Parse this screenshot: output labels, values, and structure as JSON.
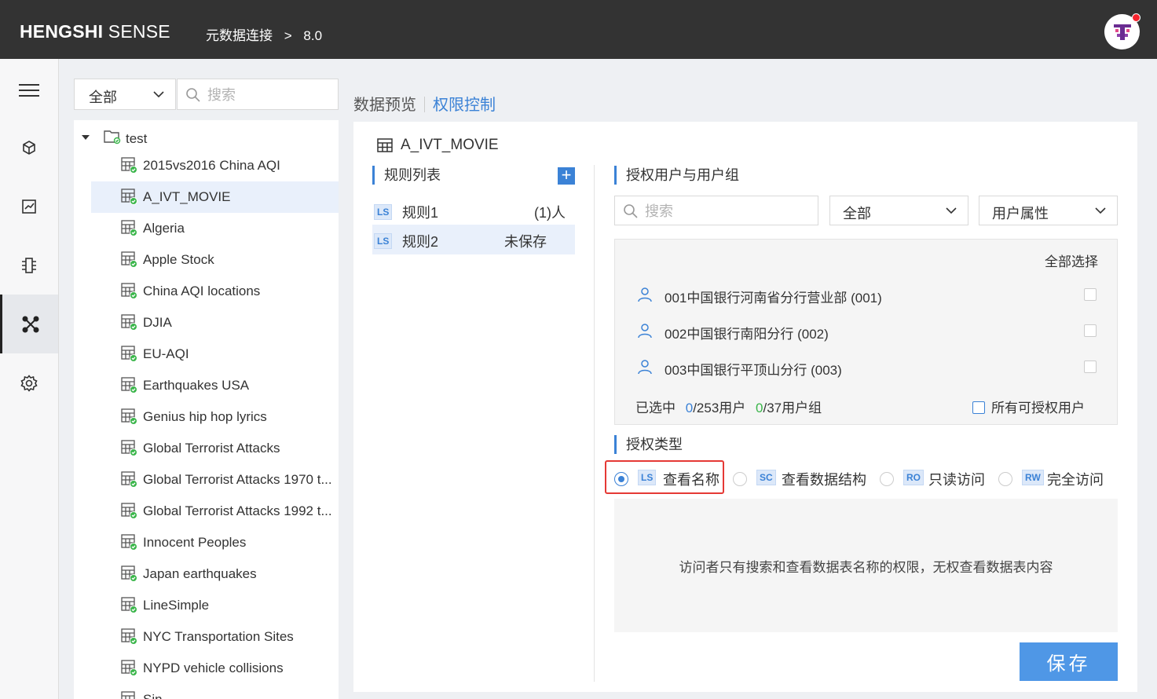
{
  "header": {
    "brand_bold": "HENGSHI",
    "brand_light": "SENSE",
    "breadcrumb": [
      "元数据连接",
      "8.0"
    ],
    "breadcrumb_sep": ">"
  },
  "leftnav": {
    "items": [
      {
        "icon": "menu-icon"
      },
      {
        "icon": "cube-icon"
      },
      {
        "icon": "chart-icon"
      },
      {
        "icon": "data-flow-icon"
      },
      {
        "icon": "connection-icon",
        "active": true
      },
      {
        "icon": "gear-icon"
      }
    ]
  },
  "tree_filter": {
    "selected": "全部",
    "search_placeholder": "搜索"
  },
  "tree": {
    "root": "test",
    "items": [
      "2015vs2016 China AQI",
      "A_IVT_MOVIE",
      "Algeria",
      "Apple Stock",
      "China AQI locations",
      "DJIA",
      "EU-AQI",
      "Earthquakes USA",
      "Genius hip hop lyrics",
      "Global Terrorist Attacks",
      "Global Terrorist Attacks 1970 t...",
      "Global Terrorist Attacks 1992 t...",
      "Innocent Peoples",
      "Japan earthquakes",
      "LineSimple",
      "NYC Transportation Sites",
      "NYPD vehicle collisions",
      "Sin..."
    ],
    "selected_index": 1
  },
  "tabs": {
    "preview": "数据预览",
    "permission": "权限控制"
  },
  "main": {
    "table_name": "A_IVT_MOVIE",
    "rules_title": "规则列表",
    "add_label": "+",
    "rules": [
      {
        "badge": "LS",
        "name": "规则1",
        "meta": "(1)人"
      },
      {
        "badge": "LS",
        "name": "规则2",
        "meta": "未保存"
      }
    ],
    "users_title": "授权用户与用户组",
    "user_search_placeholder": "搜索",
    "scope_dropdown": "全部",
    "attr_dropdown": "用户属性",
    "select_all": "全部选择",
    "users": [
      "001中国银行河南省分行营业部 (001)",
      "002中国银行南阳分行 (002)",
      "003中国银行平顶山分行 (003)"
    ],
    "summary": {
      "selected_label": "已选中",
      "users_count": "0",
      "users_total": "/253用户",
      "groups_count": "0",
      "groups_total": "/37用户组"
    },
    "all_authorizable": "所有可授权用户",
    "auth_type_title": "授权类型",
    "auth_options": [
      {
        "badge": "LS",
        "label": "查看名称",
        "checked": true
      },
      {
        "badge": "SC",
        "label": "查看数据结构",
        "checked": false
      },
      {
        "badge": "RO",
        "label": "只读访问",
        "checked": false
      },
      {
        "badge": "RW",
        "label": "完全访问",
        "checked": false
      }
    ],
    "description": "访问者只有搜索和查看数据表名称的权限，无权查看数据表内容",
    "save_label": "保存"
  },
  "colors": {
    "accent": "#3b82d6",
    "topbar": "#333333",
    "highlight": "#e53935",
    "save": "#4f97e6"
  }
}
